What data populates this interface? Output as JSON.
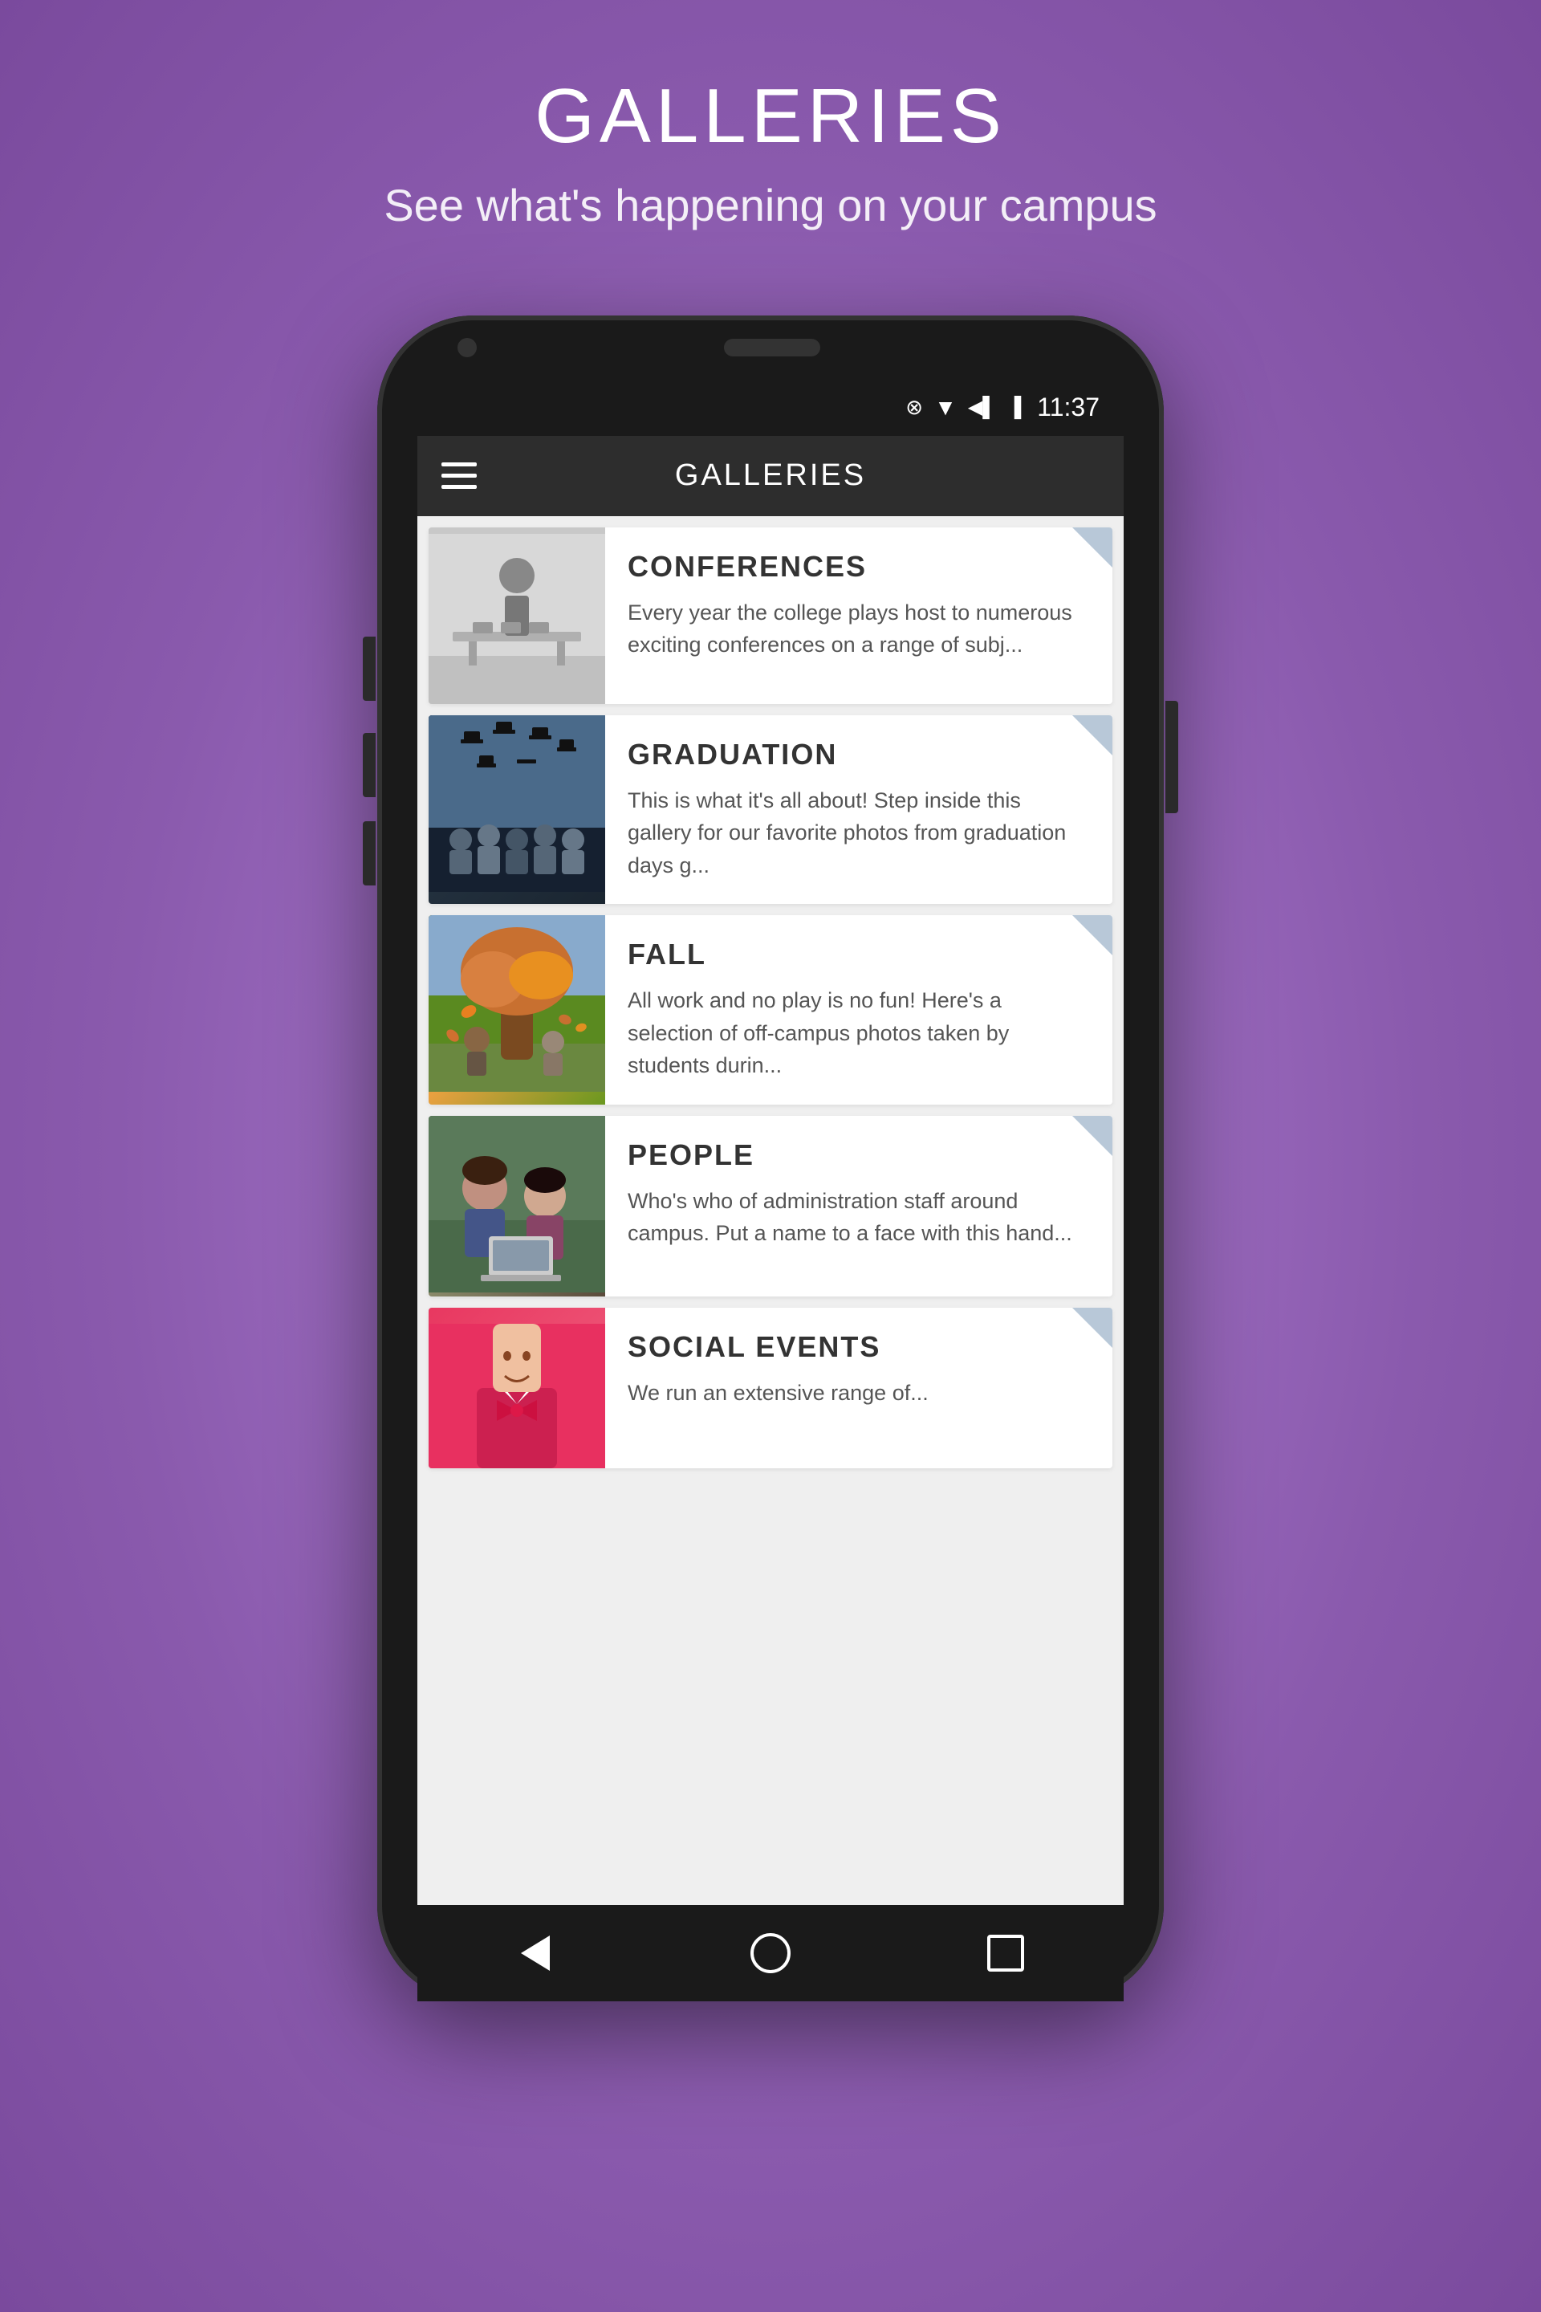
{
  "page": {
    "title": "GALLERIES",
    "subtitle": "See what's happening on\nyour campus"
  },
  "statusBar": {
    "time": "11:37",
    "icons": [
      "⊗",
      "▼",
      "◀▌",
      "🔋"
    ]
  },
  "appHeader": {
    "title": "GALLERIES"
  },
  "galleryItems": [
    {
      "id": "conferences",
      "title": "CONFERENCES",
      "description": "Every year the college plays host to numerous exciting conferences on a range of subj..."
    },
    {
      "id": "graduation",
      "title": "GRADUATION",
      "description": "This is what it's all about!  Step inside this gallery for our favorite photos from graduation days g..."
    },
    {
      "id": "fall",
      "title": "FALL",
      "description": "All work and no play is no fun!  Here's a selection of off-campus photos taken by students durin..."
    },
    {
      "id": "people",
      "title": "PEOPLE",
      "description": "Who's who of administration staff around campus.  Put a name to a face with this hand..."
    },
    {
      "id": "social-events",
      "title": "SOCIAL EVENTS",
      "description": "We run an extensive range of..."
    }
  ]
}
